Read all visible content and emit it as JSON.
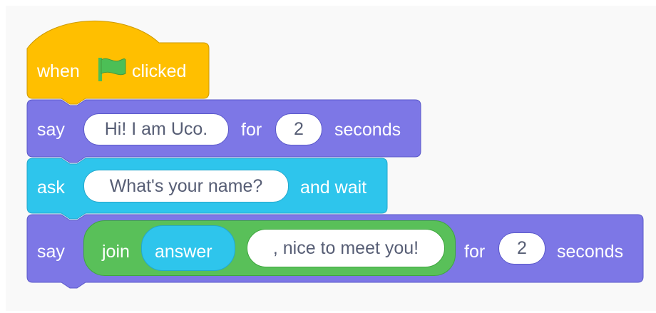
{
  "colors": {
    "events": "#ffbf00",
    "events_border": "#cc9900",
    "looks": "#9966ff",
    "looks_block": "#7d77e6",
    "sensing": "#2ec5ec",
    "operators": "#59c059",
    "flag_green": "#4cbf56",
    "input_text": "#575e75"
  },
  "hat_block": {
    "word_when": "when",
    "icon": "green-flag-icon",
    "word_clicked": "clicked"
  },
  "say_block_1": {
    "word_say": "say",
    "message_value": "Hi! I am Uco.",
    "word_for": "for",
    "seconds_value": "2",
    "word_seconds": "seconds"
  },
  "ask_block": {
    "word_ask": "ask",
    "question_value": "What's your name?",
    "word_and_wait": "and wait"
  },
  "say_block_2": {
    "word_say": "say",
    "join_word": "join",
    "answer_label": "answer",
    "join_value": ", nice to meet you!",
    "word_for": "for",
    "seconds_value": "2",
    "word_seconds": "seconds"
  }
}
